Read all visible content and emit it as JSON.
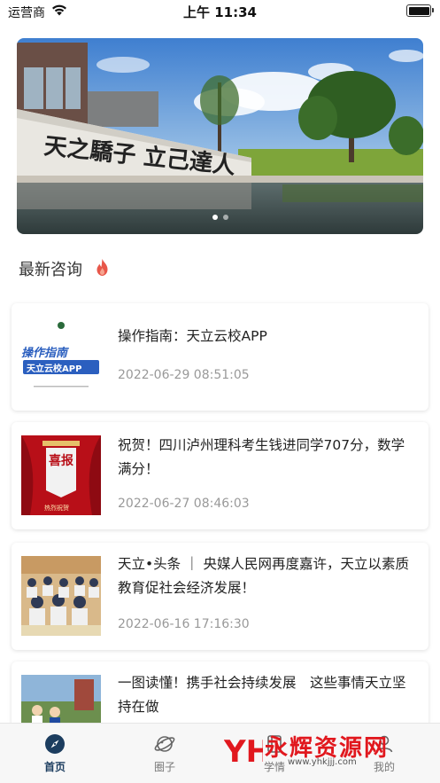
{
  "status_bar": {
    "carrier": "运营商",
    "time": "上午 11:34"
  },
  "banner": {
    "image_text": "天之驕子 立己達人",
    "slide_count": 2,
    "active_slide": 1
  },
  "section": {
    "title": "最新咨询",
    "icon": "fire-icon"
  },
  "news": [
    {
      "title": "操作指南：天立云校APP",
      "date": "2022-06-29 08:51:05",
      "thumb_caption": "操作指南",
      "thumb_subcaption": "天立云校APP"
    },
    {
      "title": "祝贺！四川泸州理科考生钱进同学707分，数学满分！",
      "date": "2022-06-27 08:46:03",
      "thumb_caption": "喜报",
      "thumb_subcaption": "热烈祝贺"
    },
    {
      "title": "天立•头条 ｜ 央媒人民网再度嘉许，天立以素质教育促社会经济发展！",
      "date": "2022-06-16 17:16:30"
    },
    {
      "title": "一图读懂！携手社会持续发展　这些事情天立坚持在做",
      "date": ""
    }
  ],
  "tab_bar": {
    "tabs": [
      {
        "label": "首页",
        "icon": "compass-icon",
        "active": true
      },
      {
        "label": "圈子",
        "icon": "planet-icon",
        "active": false
      },
      {
        "label": "学情",
        "icon": "book-icon",
        "active": false
      },
      {
        "label": "我的",
        "icon": "user-icon",
        "active": false
      }
    ]
  },
  "watermark": {
    "logo": "YH",
    "text": "永辉资源网",
    "url": "www.yhkjjj.com"
  },
  "colors": {
    "accent": "#1c3d5f",
    "fire": "#e8574a",
    "watermark": "#e1181e"
  }
}
